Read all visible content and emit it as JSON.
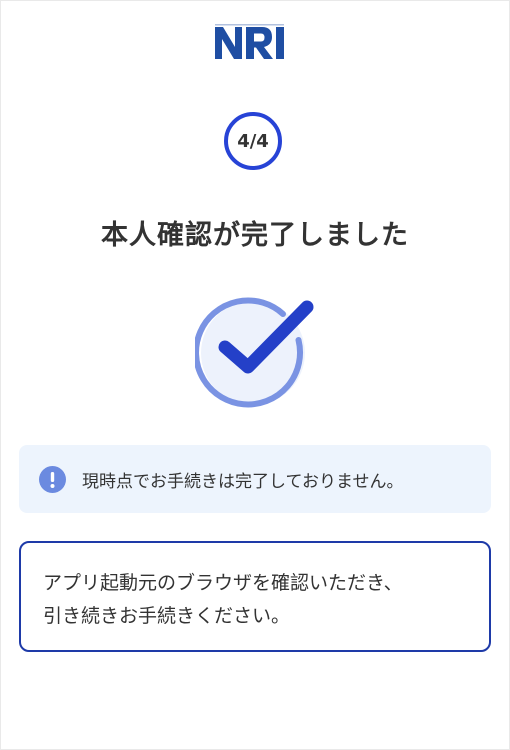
{
  "brand": {
    "logo_text": "NRI",
    "logo_color": "#1f4ea3"
  },
  "progress": {
    "step_label": "4/4",
    "current_step": 4,
    "total_steps": 4,
    "ring_color": "#2743d6"
  },
  "title": "本人確認が完了しました",
  "status_graphic": {
    "icon": "check-circle-icon",
    "check_color": "#2440c8",
    "ring_color": "#7a93e3",
    "fill_color": "#edf2fc"
  },
  "notice": {
    "icon": "info-icon",
    "icon_color": "#6b8ae0",
    "background": "#edf4fd",
    "text": "現時点でお手続きは完了しておりません。"
  },
  "message": {
    "border_color": "#1e3aa8",
    "lines": [
      "アプリ起動元のブラウザを確認いただき、",
      "引き続きお手続きください。"
    ]
  }
}
